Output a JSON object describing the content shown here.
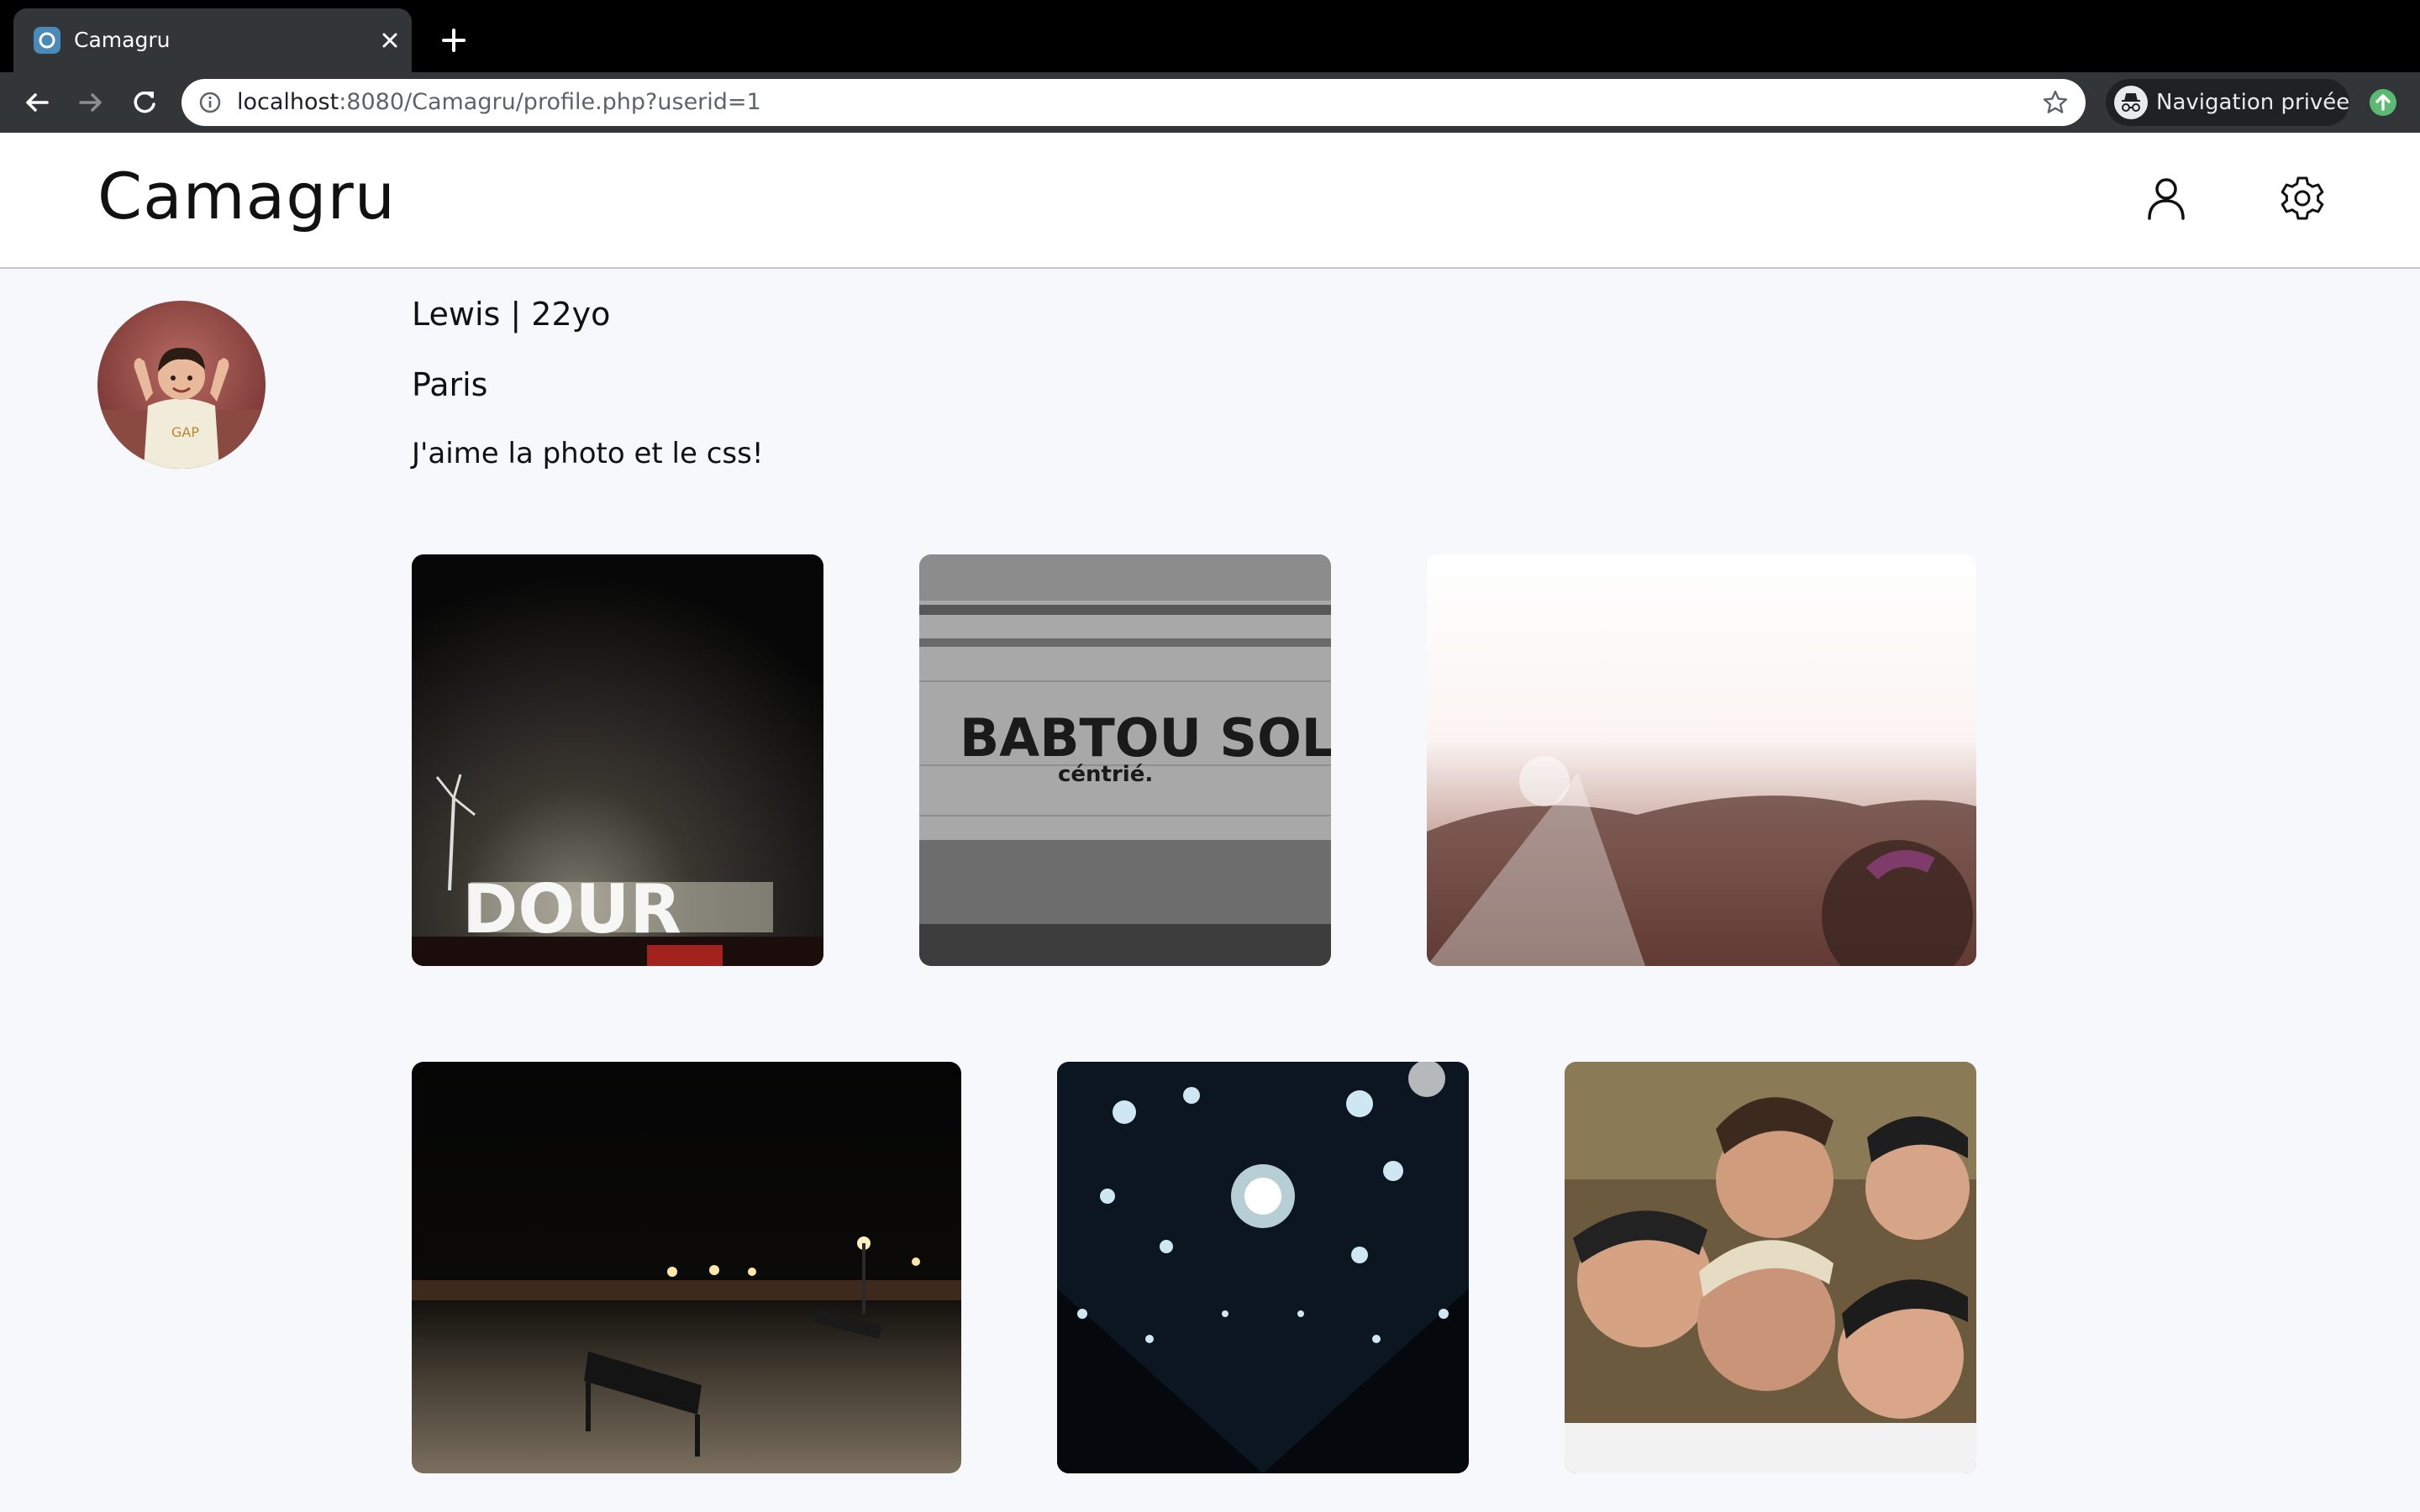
{
  "browser": {
    "tab_title": "Camagru",
    "url_host": "localhost",
    "url_path": ":8080/Camagru/profile.php?userid=1",
    "incognito_label": "Navigation privée",
    "icons": [
      "back-icon",
      "forward-icon",
      "reload-icon",
      "info-icon",
      "star-icon",
      "incognito-icon",
      "update-icon",
      "close-icon",
      "plus-icon"
    ]
  },
  "header": {
    "brand": "Camagru",
    "icons": [
      "user-icon",
      "gear-icon"
    ]
  },
  "profile": {
    "name_age": "Lewis | 22yo",
    "city": "Paris",
    "bio": "J'aime la photo et le css!"
  },
  "gallery": {
    "photos": [
      {
        "description": "night festival sign"
      },
      {
        "description": "graffiti wall"
      },
      {
        "description": "concert crowd"
      },
      {
        "description": "riverside benches at night"
      },
      {
        "description": "disco ball lights"
      },
      {
        "description": "group selfie"
      }
    ]
  }
}
